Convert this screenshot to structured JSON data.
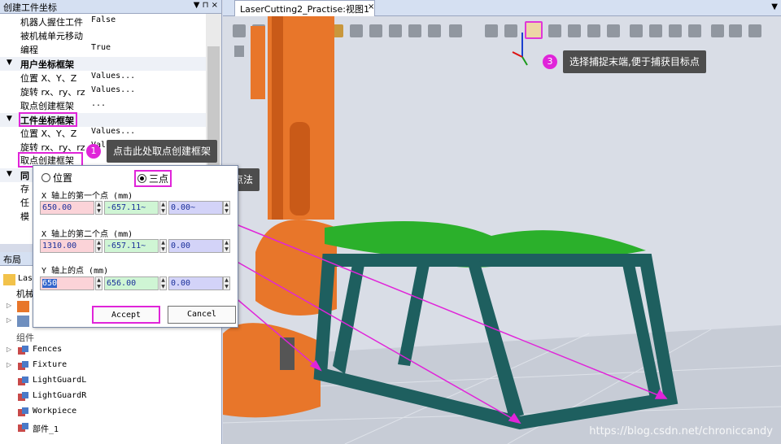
{
  "props_panel": {
    "title": "创建工件坐标",
    "title_controls": "▼ ⊓ ×",
    "rows_top": [
      {
        "key": "机器人握住工件",
        "value": "False"
      },
      {
        "key": "被机械单元移动",
        "value": ""
      },
      {
        "key": "编程",
        "value": "True"
      }
    ],
    "user_frame": {
      "title": "用户坐标框架",
      "rows": [
        {
          "key": "位置  X、Y、Z",
          "value": "Values..."
        },
        {
          "key": "旋转  rx、ry、rz",
          "value": "Values..."
        },
        {
          "key": "取点创建框架",
          "value": "..."
        }
      ]
    },
    "work_frame": {
      "title": "工件坐标框架",
      "rows": [
        {
          "key": "位置  X、Y、Z",
          "value": "Values..."
        },
        {
          "key": "旋转  rx、ry、rz",
          "value": "Values..."
        },
        {
          "key": "取点创建框架",
          "value": ""
        }
      ]
    },
    "misc": {
      "title": "同",
      "rows": [
        "存",
        "任",
        "模"
      ]
    }
  },
  "layout_panel": {
    "title": "布局",
    "title_short": "布局",
    "station": "Las",
    "mech_label": "机械",
    "components_label": "组件",
    "items": [
      {
        "label": "Fences",
        "icon": "component-icon",
        "expandable": true
      },
      {
        "label": "Fixture",
        "icon": "component-icon",
        "expandable": true
      },
      {
        "label": "LightGuardL",
        "icon": "component-icon",
        "expandable": false
      },
      {
        "label": "LightGuardR",
        "icon": "component-icon",
        "expandable": false
      },
      {
        "label": "Workpiece",
        "icon": "component-icon",
        "expandable": false
      },
      {
        "label": "部件_1",
        "icon": "component-icon",
        "expandable": false
      }
    ]
  },
  "view": {
    "tab_title": "LaserCutting2_Practise:视图1",
    "close": "×",
    "menu": "▼"
  },
  "dialog": {
    "mode_position": "位置",
    "mode_three_point": "三点",
    "selected_mode": "三点",
    "x_axis_first_label": "X 轴上的第一个点 (mm)",
    "x_axis_first": {
      "x": "650.00",
      "y": "-657.11~",
      "z": "0.00~"
    },
    "x_axis_second_label": "X 轴上的第二个点 (mm)",
    "x_axis_second": {
      "x": "1310.00",
      "y": "-657.11~",
      "z": "0.00"
    },
    "y_axis_label": "Y 轴上的点 (mm)",
    "y_axis": {
      "x": "650",
      "y": "656.00",
      "z": "0.00"
    },
    "accept": "Accept",
    "cancel": "Cancel"
  },
  "callouts": [
    {
      "number": "1",
      "text": "点击此处取点创建框架"
    },
    {
      "number": "2",
      "text": "选择三点法"
    },
    {
      "number": "3",
      "text": "选择捕捉末端,便于捕获目标点"
    }
  ],
  "watermark": "https://blog.csdn.net/chroniccandy",
  "colors": {
    "accent": "#e024d9",
    "robot": "#e8762a",
    "table_top": "#2bb02b",
    "table_frame": "#1e5f5f",
    "tooltip": "#4d4d4d"
  }
}
